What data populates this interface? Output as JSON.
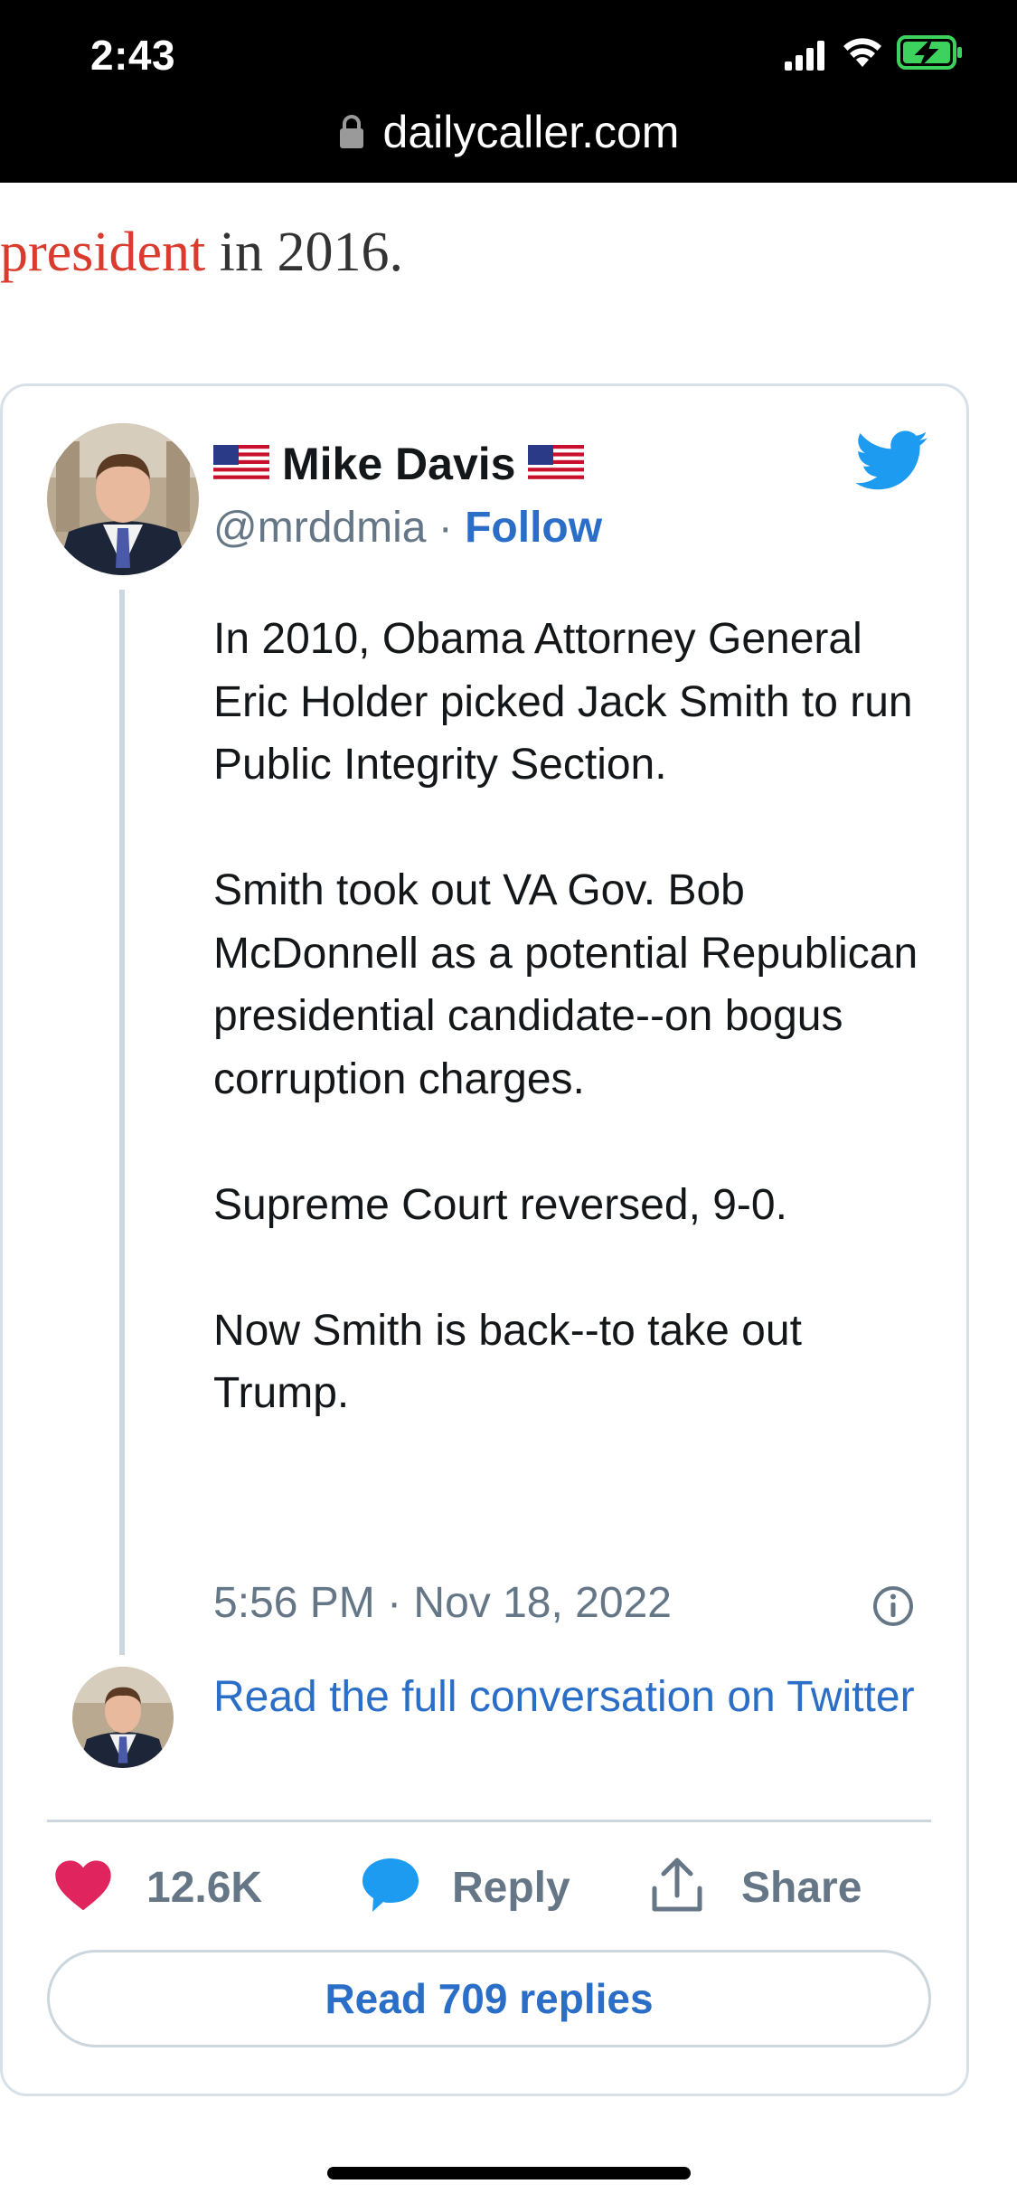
{
  "status_bar": {
    "time": "2:43"
  },
  "browser": {
    "url": "dailycaller.com"
  },
  "article": {
    "line_link": "president",
    "line_rest": " in 2016.",
    "link_color": "#d93b2e"
  },
  "tweet": {
    "author_name": "Mike Davis",
    "author_handle": "@mrddmia",
    "separator": " · ",
    "follow_label": "Follow",
    "paragraphs": [
      "In 2010, Obama Attorney General Eric Holder picked Jack Smith to run Public Integrity Section.",
      "Smith took out VA Gov. Bob McDonnell as a potential Republican presidential candidate--on bogus corruption charges.",
      "Supreme Court reversed, 9-0.",
      "Now Smith is back--to take out Trump."
    ],
    "timestamp": "5:56 PM · Nov 18, 2022",
    "read_full_label": "Read the full conversation on Twitter",
    "like_count": "12.6K",
    "reply_label": "Reply",
    "share_label": "Share",
    "read_replies_label": "Read 709 replies",
    "accent_color": "#2a6ec8",
    "twitter_blue": "#1d9bf0",
    "heart_color": "#e0245e"
  },
  "icons": {
    "signal": "signal-bars-icon",
    "wifi": "wifi-icon",
    "battery": "battery-charging-icon",
    "lock": "lock-icon",
    "flag": "us-flag-icon",
    "bird": "twitter-bird-icon",
    "info": "info-icon",
    "heart": "heart-icon",
    "reply": "speech-bubble-icon",
    "share": "share-upload-icon"
  }
}
